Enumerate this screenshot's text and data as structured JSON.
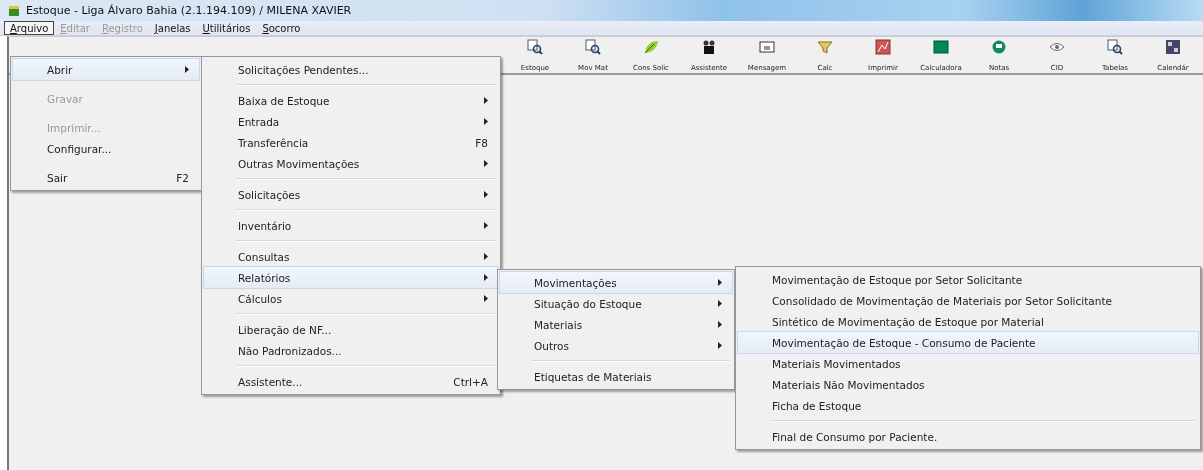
{
  "window": {
    "title": "Estoque - Liga Álvaro Bahia (2.1.194.109) / MILENA XAVIER"
  },
  "menu_bar": [
    {
      "label": "Arquivo",
      "selected": true,
      "disabled": false
    },
    {
      "label": "Editar",
      "selected": false,
      "disabled": true
    },
    {
      "label": "Registro",
      "selected": false,
      "disabled": true
    },
    {
      "label": "Janelas",
      "selected": false,
      "disabled": false
    },
    {
      "label": "Utilitários",
      "selected": false,
      "disabled": false
    },
    {
      "label": "Socorro",
      "selected": false,
      "disabled": false
    }
  ],
  "toolbar": [
    {
      "label": "Estoque"
    },
    {
      "label": "Mov Mat"
    },
    {
      "label": "Cons Solic"
    },
    {
      "label": "Assistente"
    },
    {
      "label": "Mensagem"
    },
    {
      "label": "Calc"
    },
    {
      "label": "Imprimir"
    },
    {
      "label": "Calculadora"
    },
    {
      "label": "Notas"
    },
    {
      "label": "CID"
    },
    {
      "label": "Tabelas"
    },
    {
      "label": "Calendár"
    }
  ],
  "menus": [
    {
      "items": [
        {
          "kind": "item",
          "label": "Abrir",
          "submenu": true,
          "disabled": false,
          "selected": true
        },
        {
          "kind": "gap"
        },
        {
          "kind": "item",
          "label": "Gravar",
          "disabled": true,
          "selected": false
        },
        {
          "kind": "gap"
        },
        {
          "kind": "item",
          "label": "Imprimir...",
          "disabled": true,
          "selected": false
        },
        {
          "kind": "item",
          "label": "Configurar...",
          "disabled": false,
          "selected": false
        },
        {
          "kind": "gap"
        },
        {
          "kind": "item",
          "label": "Sair",
          "shortcut": "F2",
          "disabled": false,
          "selected": false
        }
      ]
    },
    {
      "items": [
        {
          "kind": "item",
          "label": "Solicitações Pendentes...",
          "disabled": false,
          "selected": false
        },
        {
          "kind": "separator"
        },
        {
          "kind": "item",
          "label": "Baixa de Estoque",
          "submenu": true,
          "disabled": false,
          "selected": false
        },
        {
          "kind": "item",
          "label": "Entrada",
          "submenu": true,
          "disabled": false,
          "selected": false
        },
        {
          "kind": "item",
          "label": "Transferência",
          "shortcut": "F8",
          "disabled": false,
          "selected": false
        },
        {
          "kind": "item",
          "label": "Outras Movimentações",
          "submenu": true,
          "disabled": false,
          "selected": false
        },
        {
          "kind": "separator"
        },
        {
          "kind": "item",
          "label": "Solicitações",
          "submenu": true,
          "disabled": false,
          "selected": false
        },
        {
          "kind": "separator"
        },
        {
          "kind": "item",
          "label": "Inventário",
          "submenu": true,
          "disabled": false,
          "selected": false
        },
        {
          "kind": "separator"
        },
        {
          "kind": "item",
          "label": "Consultas",
          "submenu": true,
          "disabled": false,
          "selected": false
        },
        {
          "kind": "item",
          "label": "Relatórios",
          "submenu": true,
          "disabled": false,
          "selected": true
        },
        {
          "kind": "item",
          "label": "Cálculos",
          "submenu": true,
          "disabled": false,
          "selected": false
        },
        {
          "kind": "separator"
        },
        {
          "kind": "item",
          "label": "Liberação de NF...",
          "disabled": false,
          "selected": false
        },
        {
          "kind": "item",
          "label": "Não Padronizados...",
          "disabled": false,
          "selected": false
        },
        {
          "kind": "separator"
        },
        {
          "kind": "item",
          "label": "Assistente...",
          "shortcut": "Ctrl+A",
          "disabled": false,
          "selected": false
        }
      ]
    },
    {
      "items": [
        {
          "kind": "item",
          "label": "Movimentações",
          "submenu": true,
          "disabled": false,
          "selected": true
        },
        {
          "kind": "item",
          "label": "Situação do Estoque",
          "submenu": true,
          "disabled": false,
          "selected": false
        },
        {
          "kind": "item",
          "label": "Materiais",
          "submenu": true,
          "disabled": false,
          "selected": false
        },
        {
          "kind": "item",
          "label": "Outros",
          "submenu": true,
          "disabled": false,
          "selected": false
        },
        {
          "kind": "separator"
        },
        {
          "kind": "item",
          "label": "Etiquetas de Materiais",
          "disabled": false,
          "selected": false
        }
      ]
    },
    {
      "items": [
        {
          "kind": "item",
          "label": "Movimentação de Estoque por Setor Solicitante",
          "disabled": false,
          "selected": false
        },
        {
          "kind": "item",
          "label": "Consolidado de Movimentação de Materiais por Setor Solicitante",
          "disabled": false,
          "selected": false
        },
        {
          "kind": "item",
          "label": "Sintético de Movimentação de Estoque por Material",
          "disabled": false,
          "selected": false
        },
        {
          "kind": "item",
          "label": "Movimentação de Estoque - Consumo de Paciente",
          "disabled": false,
          "selected": true
        },
        {
          "kind": "item",
          "label": "Materiais Movimentados",
          "disabled": false,
          "selected": false
        },
        {
          "kind": "item",
          "label": "Materiais Não Movimentados",
          "disabled": false,
          "selected": false
        },
        {
          "kind": "item",
          "label": "Ficha de Estoque",
          "disabled": false,
          "selected": false
        },
        {
          "kind": "separator"
        },
        {
          "kind": "item",
          "label": "Final de Consumo por Paciente.",
          "disabled": false,
          "selected": false
        }
      ]
    }
  ]
}
